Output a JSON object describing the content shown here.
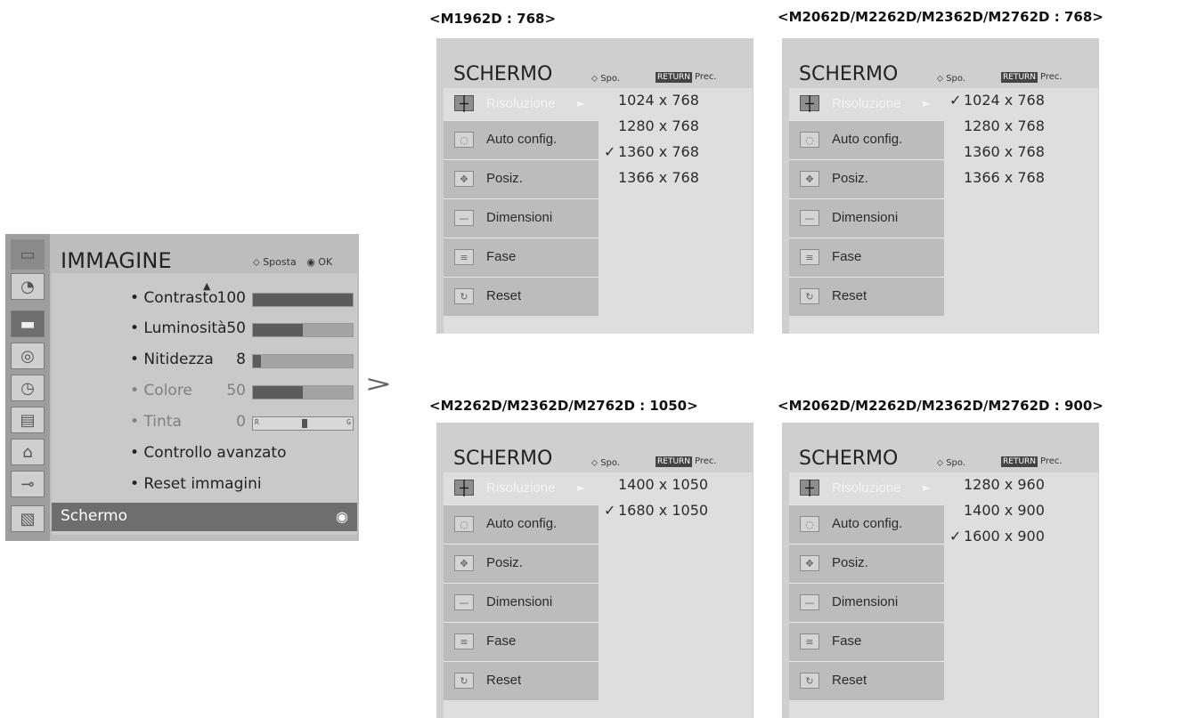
{
  "immagine_menu": {
    "title": "IMMAGINE",
    "hint_move": "Sposta",
    "hint_ok": "OK",
    "rows": [
      {
        "label": "• Contrasto",
        "value": "100",
        "level": 100,
        "dim": false
      },
      {
        "label": "• Luminosità",
        "value": "50",
        "level": 50,
        "dim": false
      },
      {
        "label": "• Nitidezza",
        "value": "8",
        "level": 8,
        "dim": false
      },
      {
        "label": "• Colore",
        "value": "50",
        "level": 50,
        "dim": true
      },
      {
        "label": "• Tinta",
        "value": "0",
        "dim": true
      },
      {
        "label": "• Controllo avanzato"
      },
      {
        "label": "• Reset immagini"
      }
    ],
    "tint_left": "R",
    "tint_right": "G",
    "selected_item": "Schermo",
    "sidebar_icons": [
      "tv-icon",
      "satellite-dish-icon",
      "picture-icon",
      "speaker-icon",
      "clock-icon",
      "option-icon",
      "lock-icon",
      "input-plug-icon",
      "usb-photo-icon"
    ]
  },
  "panels": [
    {
      "caption": "<M1962D : 768>",
      "title": "SCHERMO",
      "hint_move": "Spo.",
      "return_tag": "RETURN",
      "return_label": "Prec.",
      "items": [
        "Risoluzione",
        "Auto config.",
        "Posiz.",
        "Dimensioni",
        "Fase",
        "Reset"
      ],
      "options": [
        {
          "text": "1024 x 768",
          "checked": false
        },
        {
          "text": "1280 x 768",
          "checked": false
        },
        {
          "text": "1360 x 768",
          "checked": true
        },
        {
          "text": "1366 x 768",
          "checked": false
        }
      ]
    },
    {
      "caption": "<M2062D/M2262D/M2362D/M2762D : 768>",
      "title": "SCHERMO",
      "hint_move": "Spo.",
      "return_tag": "RETURN",
      "return_label": "Prec.",
      "items": [
        "Risoluzione",
        "Auto config.",
        "Posiz.",
        "Dimensioni",
        "Fase",
        "Reset"
      ],
      "options": [
        {
          "text": "1024 x 768",
          "checked": true
        },
        {
          "text": "1280 x 768",
          "checked": false
        },
        {
          "text": "1360 x 768",
          "checked": false
        },
        {
          "text": "1366 x 768",
          "checked": false
        }
      ]
    },
    {
      "caption": "<M2262D/M2362D/M2762D : 1050>",
      "title": "SCHERMO",
      "hint_move": "Spo.",
      "return_tag": "RETURN",
      "return_label": "Prec.",
      "items": [
        "Risoluzione",
        "Auto config.",
        "Posiz.",
        "Dimensioni",
        "Fase",
        "Reset"
      ],
      "options": [
        {
          "text": "1400 x 1050",
          "checked": false
        },
        {
          "text": "1680 x 1050",
          "checked": true
        }
      ]
    },
    {
      "caption": "<M2062D/M2262D/M2362D/M2762D : 900>",
      "title": "SCHERMO",
      "hint_move": "Spo.",
      "return_tag": "RETURN",
      "return_label": "Prec.",
      "items": [
        "Risoluzione",
        "Auto config.",
        "Posiz.",
        "Dimensioni",
        "Fase",
        "Reset"
      ],
      "options": [
        {
          "text": "1280 x 960",
          "checked": false
        },
        {
          "text": "1400 x 900",
          "checked": false
        },
        {
          "text": "1600 x 900",
          "checked": true
        }
      ]
    }
  ]
}
